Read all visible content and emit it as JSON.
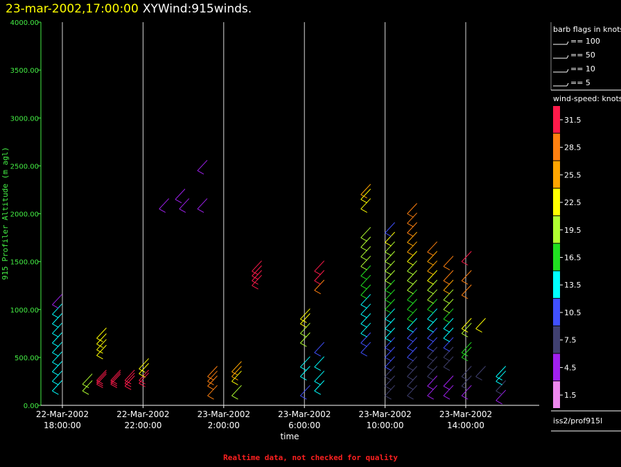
{
  "header": {
    "date_time": "23-mar-2002,17:00:00",
    "plot_name": "XYWind:915winds."
  },
  "footer": {
    "note": "Realtime data, not checked for quality"
  },
  "legend": {
    "barb_title": "barb flags in knots",
    "barbs": [
      {
        "label": "== 100"
      },
      {
        "label": "== 50"
      },
      {
        "label": "== 10"
      },
      {
        "label": "== 5"
      }
    ],
    "speed_title": "wind-speed: knots",
    "colorbar": [
      {
        "label": "31.5",
        "color": "#ff1a4a"
      },
      {
        "label": "28.5",
        "color": "#ff8010"
      },
      {
        "label": "25.5",
        "color": "#ffa500"
      },
      {
        "label": "22.5",
        "color": "#ffff00"
      },
      {
        "label": "19.5",
        "color": "#b0ff30"
      },
      {
        "label": "16.5",
        "color": "#20e020"
      },
      {
        "label": "13.5",
        "color": "#00ffff"
      },
      {
        "label": "10.5",
        "color": "#4050ff"
      },
      {
        "label": "7.5",
        "color": "#404070"
      },
      {
        "label": "4.5",
        "color": "#a020f0"
      },
      {
        "label": "1.5",
        "color": "#ee88ee"
      }
    ],
    "source": "iss2/prof915l"
  },
  "chart_data": {
    "type": "scatter",
    "title": "23-mar-2002,17:00:00 XYWind:915winds.",
    "xlabel": "time",
    "ylabel": "915 Profiler Altitude (m agl)",
    "ylim": [
      0,
      4000
    ],
    "xlim": [
      "22-Mar-2002 16:30:00",
      "23-Mar-2002 17:30:00"
    ],
    "grid": "vertical",
    "y_ticks": [
      "0.00",
      "500.00",
      "1000.00",
      "1500.00",
      "2000.00",
      "2500.00",
      "3000.00",
      "3500.00",
      "4000.00"
    ],
    "x_ticks": [
      {
        "date": "22-Mar-2002",
        "time": "18:00:00",
        "hour": 1.5
      },
      {
        "date": "22-Mar-2002",
        "time": "22:00:00",
        "hour": 5.5
      },
      {
        "date": "23-Mar-2002",
        "time": "2:00:00",
        "hour": 9.5
      },
      {
        "date": "23-Mar-2002",
        "time": "6:00:00",
        "hour": 13.5
      },
      {
        "date": "23-Mar-2002",
        "time": "10:00:00",
        "hour": 17.5
      },
      {
        "date": "23-Mar-2002",
        "time": "14:00:00",
        "hour": 21.5
      }
    ],
    "series": [
      {
        "hour": 1.0,
        "points": [
          [
            150,
            12
          ],
          [
            250,
            12
          ],
          [
            350,
            13
          ],
          [
            450,
            13
          ],
          [
            550,
            12
          ],
          [
            650,
            12
          ],
          [
            750,
            12
          ],
          [
            850,
            13
          ],
          [
            950,
            13
          ],
          [
            1050,
            4
          ]
        ]
      },
      {
        "hour": 2.5,
        "points": [
          [
            150,
            20
          ],
          [
            220,
            20
          ]
        ]
      },
      {
        "hour": 3.2,
        "points": [
          [
            220,
            31
          ],
          [
            240,
            31
          ],
          [
            260,
            31
          ],
          [
            520,
            22
          ],
          [
            580,
            22
          ],
          [
            640,
            23
          ],
          [
            700,
            23
          ]
        ]
      },
      {
        "hour": 3.9,
        "points": [
          [
            220,
            31
          ],
          [
            240,
            31
          ],
          [
            260,
            31
          ]
        ]
      },
      {
        "hour": 4.6,
        "points": [
          [
            200,
            31
          ],
          [
            230,
            31
          ],
          [
            260,
            31
          ]
        ]
      },
      {
        "hour": 5.3,
        "points": [
          [
            230,
            31
          ],
          [
            260,
            30
          ],
          [
            330,
            21
          ],
          [
            380,
            21
          ]
        ]
      },
      {
        "hour": 6.3,
        "points": [
          [
            2050,
            4
          ]
        ]
      },
      {
        "hour": 7.1,
        "points": [
          [
            2150,
            4
          ]
        ]
      },
      {
        "hour": 7.3,
        "points": [
          [
            2050,
            4
          ]
        ]
      },
      {
        "hour": 8.2,
        "points": [
          [
            2450,
            4
          ],
          [
            2050,
            4
          ]
        ]
      },
      {
        "hour": 8.7,
        "points": [
          [
            100,
            27
          ],
          [
            200,
            27
          ],
          [
            250,
            27
          ],
          [
            300,
            27
          ]
        ]
      },
      {
        "hour": 9.9,
        "points": [
          [
            100,
            20
          ],
          [
            250,
            22
          ],
          [
            300,
            24
          ],
          [
            350,
            26
          ]
        ]
      },
      {
        "hour": 10.9,
        "points": [
          [
            1250,
            31
          ],
          [
            1300,
            31
          ],
          [
            1350,
            31
          ],
          [
            1400,
            31
          ]
        ]
      },
      {
        "hour": 13.3,
        "points": [
          [
            100,
            9
          ],
          [
            300,
            14
          ],
          [
            400,
            14
          ],
          [
            650,
            20
          ],
          [
            750,
            20
          ],
          [
            850,
            21
          ],
          [
            900,
            21
          ]
        ]
      },
      {
        "hour": 14.0,
        "points": [
          [
            150,
            14
          ],
          [
            250,
            14
          ],
          [
            400,
            14
          ],
          [
            550,
            10
          ],
          [
            1200,
            28
          ],
          [
            1300,
            30
          ],
          [
            1400,
            31
          ]
        ]
      },
      {
        "hour": 16.3,
        "points": [
          [
            550,
            11
          ],
          [
            650,
            11
          ],
          [
            750,
            12
          ],
          [
            850,
            13
          ],
          [
            950,
            13
          ],
          [
            1050,
            14
          ],
          [
            1150,
            15
          ],
          [
            1250,
            16
          ],
          [
            1350,
            17
          ],
          [
            1450,
            18
          ],
          [
            1550,
            19
          ],
          [
            1650,
            19
          ],
          [
            1750,
            20
          ],
          [
            2050,
            22
          ],
          [
            2150,
            23
          ],
          [
            2200,
            25
          ]
        ]
      },
      {
        "hour": 17.5,
        "points": [
          [
            100,
            6
          ],
          [
            200,
            7
          ],
          [
            300,
            8
          ],
          [
            400,
            9
          ],
          [
            500,
            10
          ],
          [
            600,
            11
          ],
          [
            700,
            12
          ],
          [
            800,
            13
          ],
          [
            900,
            14
          ],
          [
            1000,
            15
          ],
          [
            1100,
            16
          ],
          [
            1200,
            17
          ],
          [
            1300,
            18
          ],
          [
            1400,
            19
          ],
          [
            1500,
            20
          ],
          [
            1600,
            20
          ],
          [
            1700,
            21
          ],
          [
            1800,
            9
          ]
        ]
      },
      {
        "hour": 18.6,
        "points": [
          [
            100,
            6
          ],
          [
            200,
            7
          ],
          [
            300,
            7
          ],
          [
            400,
            8
          ],
          [
            500,
            9
          ],
          [
            600,
            10
          ],
          [
            700,
            11
          ],
          [
            800,
            13
          ],
          [
            900,
            15
          ],
          [
            1000,
            16
          ],
          [
            1100,
            17
          ],
          [
            1200,
            18
          ],
          [
            1300,
            19
          ],
          [
            1400,
            20
          ],
          [
            1500,
            22
          ],
          [
            1600,
            24
          ],
          [
            1700,
            26
          ],
          [
            1800,
            27
          ],
          [
            1900,
            28
          ],
          [
            2000,
            28
          ]
        ]
      },
      {
        "hour": 19.6,
        "points": [
          [
            100,
            5
          ],
          [
            200,
            5
          ],
          [
            300,
            6
          ],
          [
            400,
            7
          ],
          [
            500,
            8
          ],
          [
            600,
            9
          ],
          [
            700,
            10
          ],
          [
            800,
            12
          ],
          [
            900,
            14
          ],
          [
            1000,
            16
          ],
          [
            1100,
            18
          ],
          [
            1200,
            20
          ],
          [
            1300,
            22
          ],
          [
            1400,
            24
          ],
          [
            1500,
            26
          ],
          [
            1600,
            28
          ]
        ]
      },
      {
        "hour": 20.4,
        "points": [
          [
            100,
            4
          ],
          [
            200,
            5
          ],
          [
            400,
            6
          ],
          [
            500,
            8
          ],
          [
            600,
            10
          ],
          [
            700,
            12
          ],
          [
            800,
            14
          ],
          [
            900,
            16
          ],
          [
            1000,
            18
          ],
          [
            1100,
            20
          ],
          [
            1200,
            26
          ],
          [
            1300,
            27
          ],
          [
            1450,
            29
          ]
        ]
      },
      {
        "hour": 21.3,
        "points": [
          [
            100,
            5
          ],
          [
            200,
            6
          ],
          [
            300,
            7
          ],
          [
            500,
            16
          ],
          [
            550,
            17
          ],
          [
            750,
            20
          ],
          [
            800,
            21
          ],
          [
            1150,
            28
          ],
          [
            1300,
            29
          ],
          [
            1500,
            31
          ]
        ]
      },
      {
        "hour": 22.0,
        "points": [
          [
            300,
            8
          ],
          [
            800,
            22
          ]
        ]
      },
      {
        "hour": 23.0,
        "points": [
          [
            50,
            5
          ],
          [
            150,
            8
          ],
          [
            250,
            12
          ],
          [
            300,
            13
          ]
        ]
      }
    ]
  }
}
